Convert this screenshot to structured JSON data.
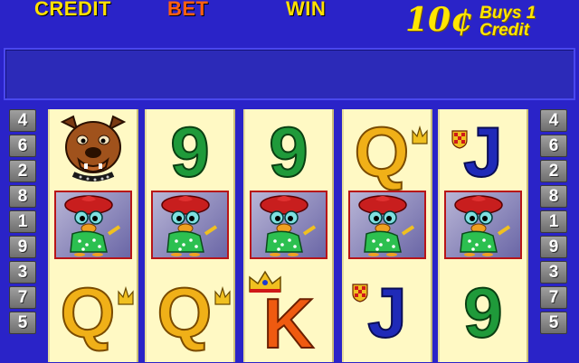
{
  "header": {
    "credit_label": "CREDIT",
    "bet_label": "BET",
    "win_label": "WIN",
    "denomination": "10¢",
    "buys_line1": "Buys 1",
    "buys_line2": "Credit"
  },
  "message_bar": {
    "text": ""
  },
  "line_buttons_left": [
    "4",
    "6",
    "2",
    "8",
    "1",
    "9",
    "3",
    "7",
    "5"
  ],
  "line_buttons_right": [
    "4",
    "6",
    "2",
    "8",
    "1",
    "9",
    "3",
    "7",
    "5"
  ],
  "reels": [
    {
      "top": "bulldog",
      "middle": "duck",
      "bottom": "Q"
    },
    {
      "top": "9",
      "middle": "duck",
      "bottom": "Q"
    },
    {
      "top": "9",
      "middle": "duck",
      "bottom": "K"
    },
    {
      "top": "Q",
      "middle": "duck",
      "bottom": "J"
    },
    {
      "top": "J",
      "middle": "duck",
      "bottom": "9"
    }
  ],
  "symbols": {
    "nine": "9",
    "queen": "Q",
    "jack": "J",
    "king": "K"
  },
  "icons": {
    "crown": "crown-icon",
    "shield": "shield-icon",
    "duck": "duck-icon",
    "bulldog": "bulldog-icon"
  },
  "colors": {
    "background": "#2a23c8",
    "reel_bg": "#fff9c4",
    "credit_text": "#ffe000",
    "bet_text": "#ff6010",
    "win_text": "#ffe000",
    "denom_text": "#ffe600",
    "line_button": "#8a8a8a"
  }
}
